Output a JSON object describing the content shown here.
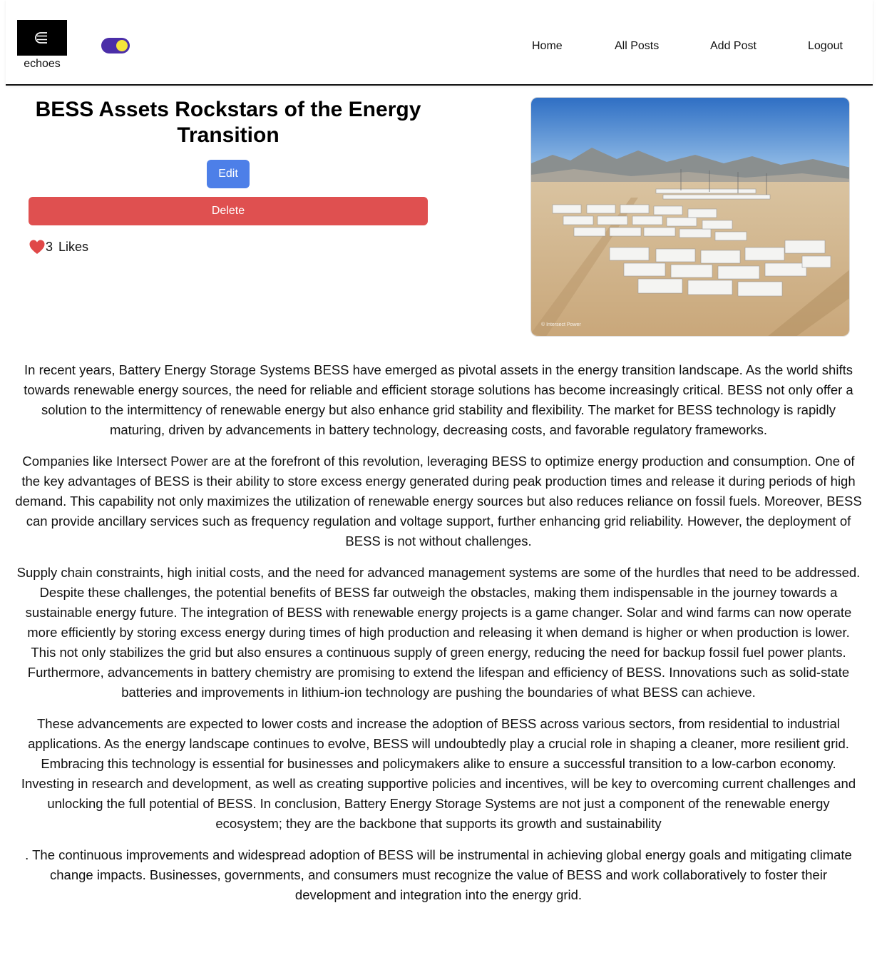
{
  "brand": {
    "logo_glyph": "⋲",
    "name": "echoes",
    "logo_bg": "#000000"
  },
  "theme_toggle": {
    "state": "on",
    "track_color": "#4b2ea8",
    "knob_color": "#f5e53b"
  },
  "nav": {
    "home": "Home",
    "all_posts": "All Posts",
    "add_post": "Add Post",
    "logout": "Logout"
  },
  "post": {
    "title": "BESS Assets Rockstars of the Energy Transition",
    "edit_label": "Edit",
    "delete_label": "Delete",
    "likes_count": "3",
    "likes_label": "Likes",
    "image_credit": "© Intersect Power",
    "image_alt": "Aerial view of battery energy storage containers in a desert",
    "paragraphs": [
      "In recent years, Battery Energy Storage Systems BESS have emerged as pivotal assets in the energy transition landscape. As the world shifts towards renewable energy sources, the need for reliable and efficient storage solutions has become increasingly critical. BESS not only offer a solution to the intermittency of renewable energy but also enhance grid stability and flexibility. The market for BESS technology is rapidly maturing, driven by advancements in battery technology, decreasing costs, and favorable regulatory frameworks.",
      "Companies like Intersect Power are at the forefront of this revolution, leveraging BESS to optimize energy production and consumption. One of the key advantages of BESS is their ability to store excess energy generated during peak production times and release it during periods of high demand. This capability not only maximizes the utilization of renewable energy sources but also reduces reliance on fossil fuels. Moreover, BESS can provide ancillary services such as frequency regulation and voltage support, further enhancing grid reliability. However, the deployment of BESS is not without challenges.",
      "Supply chain constraints, high initial costs, and the need for advanced management systems are some of the hurdles that need to be addressed. Despite these challenges, the potential benefits of BESS far outweigh the obstacles, making them indispensable in the journey towards a sustainable energy future. The integration of BESS with renewable energy projects is a game changer. Solar and wind farms can now operate more efficiently by storing excess energy during times of high production and releasing it when demand is higher or when production is lower. This not only stabilizes the grid but also ensures a continuous supply of green energy, reducing the need for backup fossil fuel power plants. Furthermore, advancements in battery chemistry are promising to extend the lifespan and efficiency of BESS. Innovations such as solid-state batteries and improvements in lithium-ion technology are pushing the boundaries of what BESS can achieve.",
      "These advancements are expected to lower costs and increase the adoption of BESS across various sectors, from residential to industrial applications. As the energy landscape continues to evolve, BESS will undoubtedly play a crucial role in shaping a cleaner, more resilient grid. Embracing this technology is essential for businesses and policymakers alike to ensure a successful transition to a low-carbon economy. Investing in research and development, as well as creating supportive policies and incentives, will be key to overcoming current challenges and unlocking the full potential of BESS. In conclusion, Battery Energy Storage Systems are not just a component of the renewable energy ecosystem; they are the backbone that supports its growth and sustainability",
      ". The continuous improvements and widespread adoption of BESS will be instrumental in achieving global energy goals and mitigating climate change impacts. Businesses, governments, and consumers must recognize the value of BESS and work collaboratively to foster their development and integration into the energy grid."
    ]
  },
  "colors": {
    "edit_button": "#4d7fe8",
    "delete_button": "#df5050",
    "heart": "#e04848"
  }
}
